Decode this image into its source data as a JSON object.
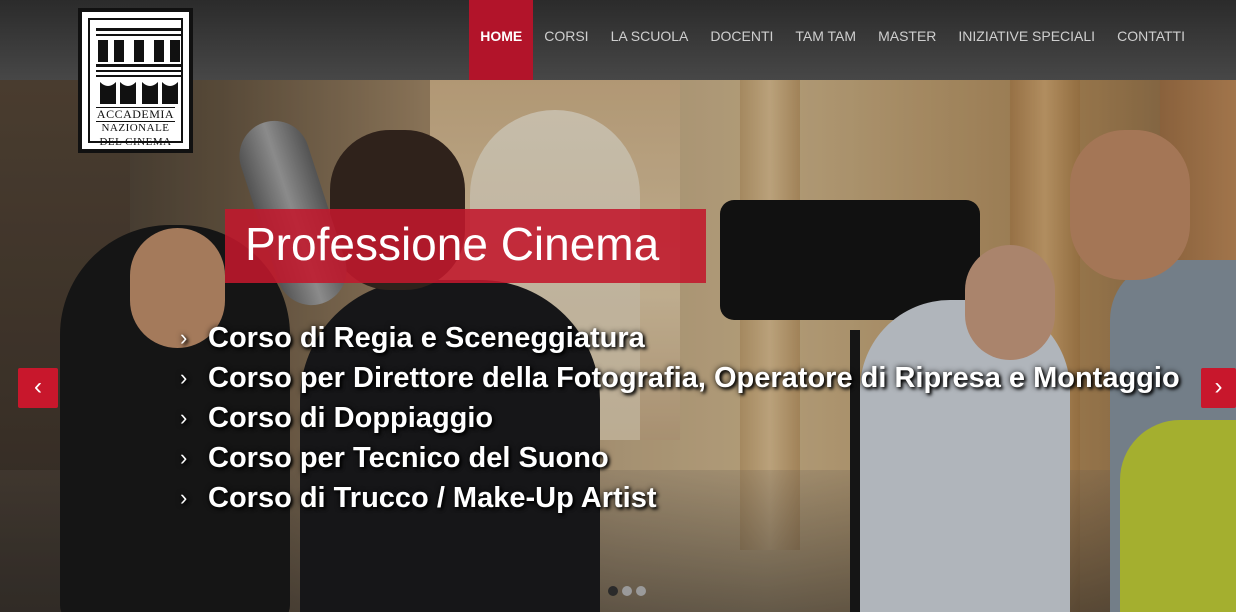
{
  "brand": {
    "logo_line1": "ACCADEMIA",
    "logo_line2": "NAZIONALE",
    "logo_line3": "DEL CINEMA"
  },
  "nav": {
    "items": [
      {
        "label": "HOME",
        "active": true
      },
      {
        "label": "CORSI",
        "active": false
      },
      {
        "label": "LA SCUOLA",
        "active": false
      },
      {
        "label": "DOCENTI",
        "active": false
      },
      {
        "label": "TAM TAM",
        "active": false
      },
      {
        "label": "MASTER",
        "active": false
      },
      {
        "label": "INIZIATIVE SPECIALI",
        "active": false
      },
      {
        "label": "CONTATTI",
        "active": false
      }
    ]
  },
  "slide": {
    "title": "Professione Cinema",
    "courses": [
      "Corso di Regia e Sceneggiatura",
      "Corso per Direttore della Fotografia, Operatore di Ripresa e Montaggio",
      "Corso di Doppiaggio",
      "Corso per Tecnico del Suono",
      "Corso di Trucco / Make-Up Artist"
    ],
    "bullet": "›"
  },
  "carousel": {
    "prev": "‹",
    "next": "›",
    "slide_count": 3,
    "active_index": 0
  },
  "colors": {
    "accent": "#b2142a",
    "topbar": "#3a3a3a"
  }
}
